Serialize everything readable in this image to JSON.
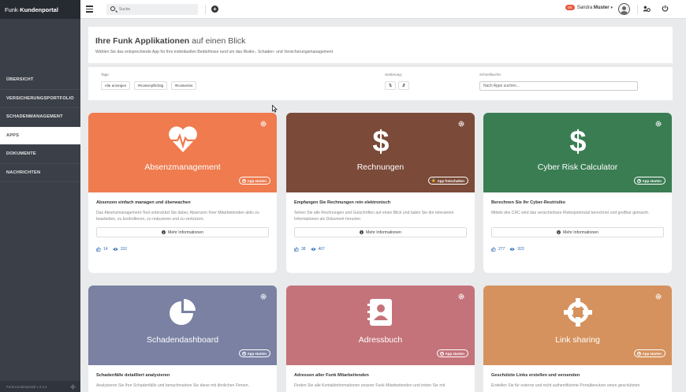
{
  "brand": {
    "light": "Funk",
    "bold": "Kundenportal"
  },
  "sidebar": {
    "items": [
      {
        "label": "ÜBERSICHT"
      },
      {
        "label": "VERSICHERUNGSPORTFOLIO"
      },
      {
        "label": "SCHADENMANAGEMENT"
      },
      {
        "label": "APPS"
      },
      {
        "label": "DOKUMENTE"
      },
      {
        "label": "NACHRICHTEN"
      }
    ],
    "active_index": 3,
    "footer": "Funk Kundenportal v 2.3.2"
  },
  "topbar": {
    "search_placeholder": "Suche",
    "user_badge": "DE",
    "user_first": "Sandra",
    "user_last": "Muster"
  },
  "header": {
    "title_bold": "Ihre Funk Applikationen",
    "title_rest": "auf einen Blick",
    "subtitle": "Wählen Sie das entsprechende App für Ihre individuellen Bedürfnisse rund um das Risiko-, Schaden- und Versicherungsmanagement"
  },
  "filters": {
    "tags_label": "Tags:",
    "tags": [
      "Alle anzeigen",
      "#Kostenpflichtig",
      "#Kostenlos"
    ],
    "sort_label": "Sortierung:",
    "quick_label": "Schnellsuche:",
    "quick_placeholder": "Nach Apps suchen..."
  },
  "colors": {
    "orange": "#ef7b4f",
    "brown": "#7b4a38",
    "green": "#3a7d53",
    "slate": "#7a81a3",
    "rose": "#c4737a",
    "tan": "#d5925e"
  },
  "cards": [
    {
      "title": "Absenzmanagement",
      "icon": "heart-pulse-icon",
      "button": "App starten",
      "heading": "Absenzen einfach managen und überwachen",
      "desc": "Das Absenzmanagement-Tool unterstützt Sie dabei, Absenzen Ihrer Mitarbeitenden aktiv zu bearbeiten, zu kontrollieren, zu reduzieren und zu verkürzen.",
      "more": "Mehr Informationen",
      "likes": "14",
      "views": "152"
    },
    {
      "title": "Rechnungen",
      "icon": "dollar-icon",
      "button": "App freischalten",
      "heading": "Empfangen Sie Rechnungen rein elektronisch",
      "desc": "Sehen Sie alle Rechnungen und Gutschriften auf einen Blick und laden Sie die relevanten Informationen als Dokument herunter.",
      "more": "Mehr Informationen",
      "likes": "38",
      "views": "407"
    },
    {
      "title": "Cyber Risk Calculator",
      "icon": "dollar-icon",
      "button": "App starten",
      "heading": "Berechnen Sie Ihr Cyber-Restrisiko",
      "desc": "Mittels des CRC wird das versicherbare Risikopotenzial berechnet und greifbar gemacht.",
      "more": "Mehr Informationen",
      "likes": "277",
      "views": "923"
    },
    {
      "title": "Schadendashboard",
      "icon": "pie-chart-icon",
      "button": "App starten",
      "heading": "Schadenfälle detailliert analysieren",
      "desc": "Analysieren Sie Ihre Schadenfälle und benachmarken Sie diese mit ähnlichen Firmen."
    },
    {
      "title": "Adressbuch",
      "icon": "address-book-icon",
      "button": "App starten",
      "heading": "Adressen aller Funk Mitarbeitenden",
      "desc": "Finden Sie alle Kontaktinformationen unserer Funk Mitarbeitenden und treten Sie mit"
    },
    {
      "title": "Link sharing",
      "icon": "crosshair-icon",
      "button": "App starten",
      "heading": "Geschützte Links erstellen und versenden",
      "desc": "Erstellen Sie für externe und nicht authentifizierte Portalbenutzer einen geschützten"
    }
  ]
}
